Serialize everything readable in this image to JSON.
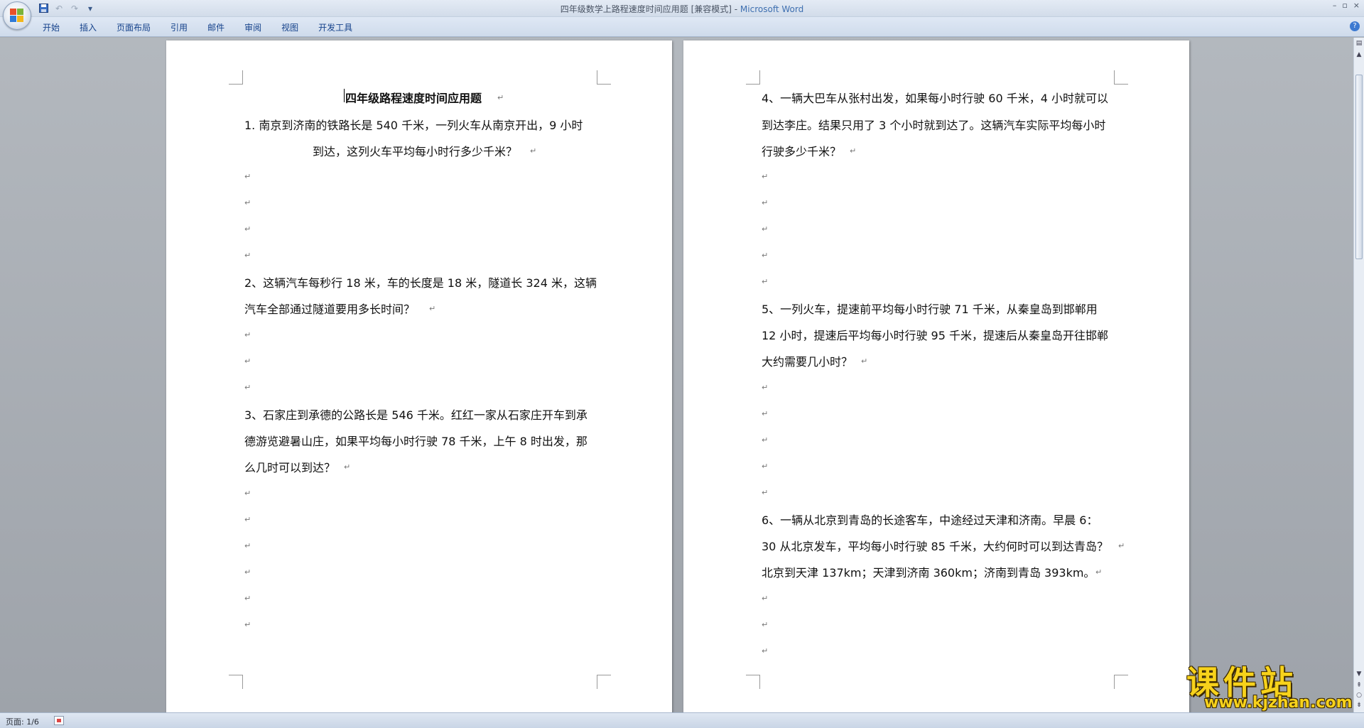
{
  "window": {
    "doc_name": "四年级数学上路程速度时间应用题 [兼容模式] - ",
    "app_name": "Microsoft Word",
    "controls": [
      "–",
      "▫",
      "×"
    ]
  },
  "qat": {
    "save_icon": "save-icon",
    "undo_icon": "undo-icon",
    "redo_icon": "redo-icon",
    "customize": "▾"
  },
  "ribbon": {
    "tabs": [
      "开始",
      "插入",
      "页面布局",
      "引用",
      "邮件",
      "审阅",
      "视图",
      "开发工具"
    ],
    "help": "?"
  },
  "page_left": {
    "title": "四年级路程速度时间应用题",
    "q1_line1": "1. 南京到济南的铁路长是 540 千米，一列火车从南京开出，9 小时",
    "q1_line2": "到达，这列火车平均每小时行多少千米？",
    "q2_line1": "2、这辆汽车每秒行 18 米，车的长度是 18 米，隧道长 324 米，这辆",
    "q2_line2": "汽车全部通过隧道要用多长时间？",
    "q3_line1": "3、石家庄到承德的公路长是 546 千米。红红一家从石家庄开车到承",
    "q3_line2": "德游览避暑山庄，如果平均每小时行驶 78 千米，上午 8 时出发，那",
    "q3_line3": "么几时可以到达？"
  },
  "page_right": {
    "q4_line1": "4、一辆大巴车从张村出发，如果每小时行驶 60 千米，4 小时就可以",
    "q4_line2": "到达李庄。结果只用了 3 个小时就到达了。这辆汽车实际平均每小时",
    "q4_line3": "行驶多少千米？",
    "q5_line1": "5、一列火车，提速前平均每小时行驶 71 千米，从秦皇岛到邯郸用",
    "q5_line2": "12 小时，提速后平均每小时行驶 95 千米，提速后从秦皇岛开往邯郸",
    "q5_line3": "大约需要几小时？",
    "q6_line1": "6、一辆从北京到青岛的长途客车，中途经过天津和济南。早晨 6：",
    "q6_line2": "30 从北京发车，平均每小时行驶 85 千米，大约何时可以到达青岛？",
    "q6_line3": "北京到天津 137km；天津到济南 360km；济南到青岛 393km。"
  },
  "paragraph_mark": "↵",
  "status": {
    "page": "页面: 1/6"
  },
  "watermark": {
    "name": "课件站",
    "url": "www.kjzhan.com"
  },
  "colors": {
    "accent": "#3e6fb0",
    "tab_text": "#15428b",
    "watermark": "#f7d21b"
  }
}
